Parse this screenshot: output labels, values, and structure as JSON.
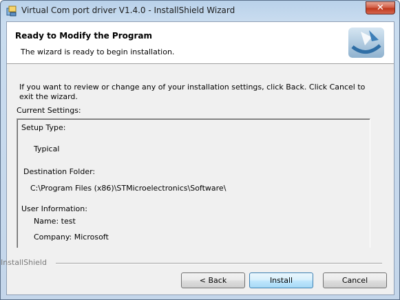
{
  "window": {
    "title": "Virtual Com port driver V1.4.0 - InstallShield Wizard",
    "close_label": "✕"
  },
  "header": {
    "title": "Ready to Modify the Program",
    "subtitle": "The wizard is ready to begin installation."
  },
  "body": {
    "intro": "If you want to review or change any of your installation settings, click Back. Click Cancel to exit the wizard.",
    "current_settings_label": "Current Settings:"
  },
  "settings": {
    "setup_type_label": "Setup Type:",
    "setup_type_value": "Typical",
    "destination_label": "Destination Folder:",
    "destination_value": "C:\\Program Files (x86)\\STMicroelectronics\\Software\\",
    "user_info_label": "User Information:",
    "name_line": "Name: test",
    "company_line": "Company: Microsoft"
  },
  "footer": {
    "brand": "InstallShield",
    "back_label": "< Back",
    "install_label": "Install",
    "cancel_label": "Cancel"
  },
  "colors": {
    "title_bar": "#c4d6ea",
    "close_button": "#c0391e",
    "default_button_border": "#3c7fb1"
  },
  "icons": {
    "app": "installer-icon",
    "logo": "installshield-logo"
  }
}
